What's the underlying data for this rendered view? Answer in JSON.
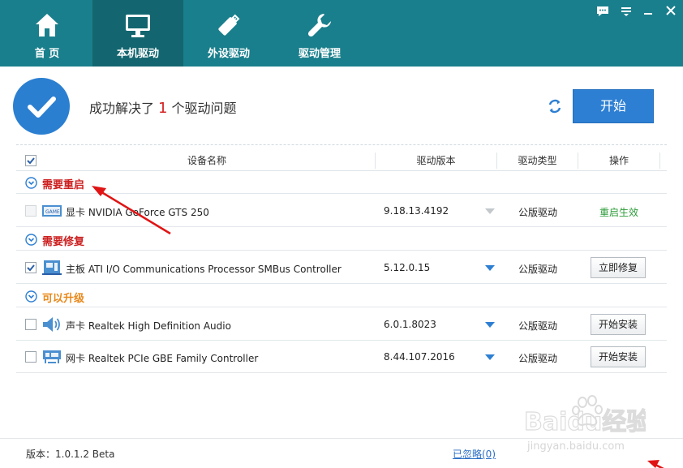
{
  "nav": {
    "items": [
      {
        "label": "首 页",
        "icon": "home-icon"
      },
      {
        "label": "本机驱动",
        "icon": "monitor-icon"
      },
      {
        "label": "外设驱动",
        "icon": "usb-drive-icon"
      },
      {
        "label": "驱动管理",
        "icon": "wrench-icon"
      }
    ],
    "active": 1
  },
  "status": {
    "prefix": "成功解决了",
    "count": "1",
    "suffix": "个驱动问题",
    "start_label": "开始"
  },
  "table": {
    "headers": {
      "name": "设备名称",
      "version": "驱动版本",
      "type": "驱动类型",
      "action": "操作"
    },
    "groups": [
      {
        "label": "需要重启",
        "color": "#cc1f1f",
        "rows": [
          {
            "name": "显卡 NVIDIA GeForce GTS 250",
            "version": "9.18.13.4192",
            "type": "公版驱动",
            "action": "重启生效",
            "icon": "graphics-card-icon"
          }
        ]
      },
      {
        "label": "需要修复",
        "color": "#cc1f1f",
        "rows": [
          {
            "name": "主板 ATI I/O Communications Processor SMBus Controller",
            "version": "5.12.0.15",
            "type": "公版驱动",
            "action": "立即修复",
            "icon": "motherboard-icon"
          }
        ]
      },
      {
        "label": "可以升级",
        "color": "#e8881a",
        "rows": [
          {
            "name": "声卡 Realtek High Definition Audio",
            "version": "6.0.1.8023",
            "type": "公版驱动",
            "action": "开始安装",
            "icon": "speaker-icon"
          },
          {
            "name": "网卡 Realtek PCIe GBE Family Controller",
            "version": "8.44.107.2016",
            "type": "公版驱动",
            "action": "开始安装",
            "icon": "network-card-icon"
          }
        ]
      }
    ]
  },
  "footer": {
    "version": "版本：1.0.1.2 Beta",
    "ignored": "已忽略(0)"
  },
  "watermark": {
    "brand": "Baidu经验",
    "url": "jingyan.baidu.com"
  },
  "colors": {
    "topbar": "#1a7f8c",
    "accent_blue": "#2d7fd3",
    "success_green": "#2e9d3a"
  }
}
